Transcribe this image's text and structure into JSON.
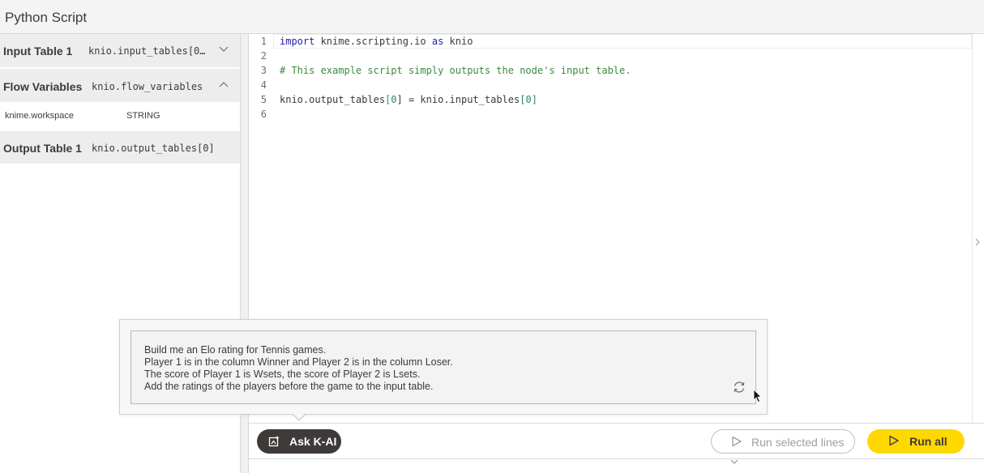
{
  "window": {
    "title": "Python Script"
  },
  "sidebar": {
    "input_table": {
      "label": "Input Table 1",
      "code": "knio.input_tables[0…",
      "chevron": "chevron-down-icon"
    },
    "flow_variables": {
      "label": "Flow Variables",
      "code": "knio.flow_variables",
      "chevron": "chevron-up-icon",
      "items": [
        {
          "name": "knime.workspace",
          "type": "STRING"
        }
      ]
    },
    "output_table": {
      "label": "Output Table 1",
      "code": "knio.output_tables[0]"
    }
  },
  "editor": {
    "line_numbers": [
      "1",
      "2",
      "3",
      "4",
      "5",
      "6"
    ],
    "lines": {
      "l1_kw1": "import",
      "l1_mod": " knime.scripting.io ",
      "l1_kw2": "as",
      "l1_alias": " knio",
      "l3_comment": "# This example script simply outputs the node's input table.",
      "l5_a": "knio.output_tables",
      "l5_b": "[",
      "l5_c": "0",
      "l5_d": "] = knio.input_tables",
      "l5_e": "[",
      "l5_f": "0",
      "l5_g": "]"
    }
  },
  "prompt_popover": {
    "lines": [
      "Build me an Elo rating for Tennis games.",
      "Player 1 is in the column Winner and Player 2 is in the column Loser.",
      "The score of Player 1 is Wsets, the score of Player 2 is Lsets.",
      "Add the ratings of the players before the game to the input table."
    ],
    "regenerate_icon": "refresh-icon"
  },
  "toolbar": {
    "ask_ai": "Ask K-AI",
    "run_selected": "Run selected lines",
    "run_all": "Run all"
  },
  "colors": {
    "run_all_bg": "#ffd800",
    "ask_ai_bg": "#3e3a39",
    "keyword": "#1d1da8",
    "comment": "#3d8a3d"
  }
}
